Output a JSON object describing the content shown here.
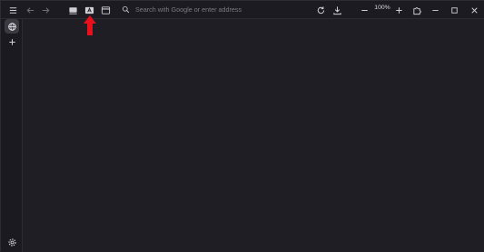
{
  "toolbar": {
    "address_placeholder": "Search with Google or enter address",
    "zoom_level": "100%"
  },
  "colors": {
    "background": "#1f1e24",
    "toolbar": "#1c1b21",
    "sidebar": "#1b1a20",
    "annotation_arrow": "#e8101c"
  },
  "icons": {
    "menu": "hamburger-menu-icon",
    "back": "back-arrow-icon",
    "forward": "forward-arrow-icon",
    "reader": "reader-view-icon",
    "translate": "translate-icon",
    "window": "window-icon",
    "search": "search-icon",
    "reload": "reload-icon",
    "download": "download-icon",
    "zoom_out": "minus-icon",
    "zoom_in": "plus-icon",
    "extensions": "puzzle-icon",
    "minimize": "minimize-icon",
    "maximize": "maximize-icon",
    "close": "close-icon",
    "web_panel": "globe-icon",
    "add_panel": "plus-icon",
    "settings": "gear-icon"
  }
}
